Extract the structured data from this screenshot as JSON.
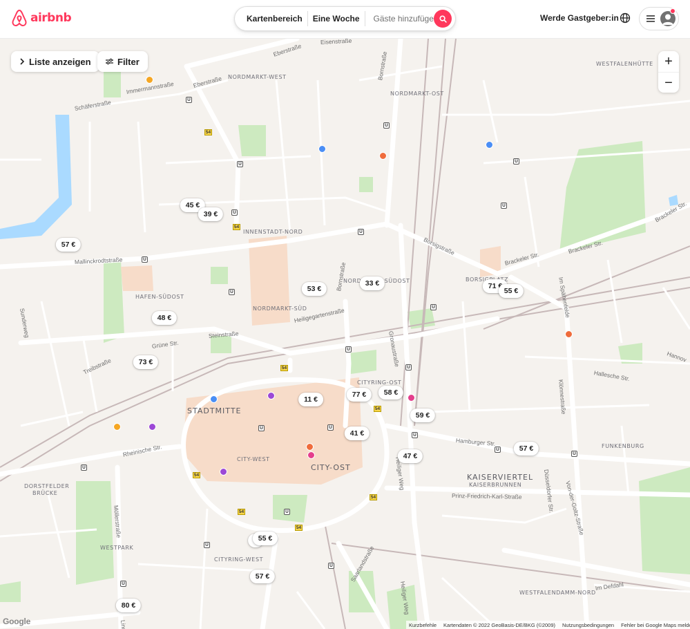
{
  "header": {
    "brand": "airbnb",
    "search": {
      "location": "Kartenbereich",
      "dates": "Eine Woche",
      "guests_placeholder": "Gäste hinzufügen"
    },
    "host_link": "Werde Gastgeber:in",
    "icons": [
      "airbnb-logo-icon",
      "search-icon",
      "globe-icon",
      "menu-icon",
      "avatar-icon"
    ],
    "accent_color": "#ff385c"
  },
  "map_controls": {
    "show_list": "Liste anzeigen",
    "filter": "Filter",
    "zoom_in": "+",
    "zoom_out": "−"
  },
  "price_pins": [
    {
      "label": "45 €"
    },
    {
      "label": "39 €"
    },
    {
      "label": "57 €"
    },
    {
      "label": "53 €"
    },
    {
      "label": "33 €"
    },
    {
      "label": "71 €"
    },
    {
      "label": "55 €"
    },
    {
      "label": "48 €"
    },
    {
      "label": "73 €"
    },
    {
      "label": "11 €"
    },
    {
      "label": "77 €"
    },
    {
      "label": "58 €"
    },
    {
      "label": "59 €"
    },
    {
      "label": "41 €"
    },
    {
      "label": "47 €"
    },
    {
      "label": "57 €"
    },
    {
      "label": "5"
    },
    {
      "label": "55 €"
    },
    {
      "label": "57 €"
    },
    {
      "label": "80 €"
    }
  ],
  "districts": {
    "nordmarkt_west": "NORDMARKT-WEST",
    "nordmarkt_ost": "NORDMARKT-OST",
    "westfalenhuette": "WESTFALENHÜTTE",
    "innenstadt_nord": "INNENSTADT-NORD",
    "hafen_suedost": "HAFEN-SÜDOST",
    "nordmarkt_sued": "NORDMARKT-SÜD",
    "nordmarkt_suedost": "NORDMARKT-SÜDOST",
    "borsigplatz": "BORSIGPLATZ",
    "cityring_ost": "CITYRING-OST",
    "stadtmitte": "STADTMITTE",
    "city_west": "CITY-WEST",
    "city_ost": "CITY-OST",
    "kaiserviertel": "KAISERVIERTEL",
    "kaiserbrunnen": "KAISERBRUNNEN",
    "funkenburg": "FUNKENBURG",
    "dorstfelder": "DORSTFELDER",
    "bruecke": "BRÜCKE",
    "westpark": "WESTPARK",
    "cityring_west": "CITYRING-WEST",
    "westfalendamm_nord": "WESTFALENDAMM-NORD"
  },
  "streets": {
    "eisenstrasse": "Eisenstraße",
    "eberstrasse1": "Eberstraße",
    "eberstrasse2": "Eberstraße",
    "immermannstrasse": "Immermannstraße",
    "schaeferstrasse": "Schäferstraße",
    "bornstrasse_n": "Bornstraße",
    "mallinckrodtstrasse": "Mallinckrodtstraße",
    "borsigstrasse": "Borsigstraße",
    "brackeler1": "Brackeler Str.",
    "brackeler2": "Brackeler Str.",
    "brackeler3": "Brackeler Str.",
    "sunderweg": "Sunderweg",
    "heiligegartenstrasse": "Heiligegartenstraße",
    "bornstrasse_s": "Bornstraße",
    "im_spaethenfelde": "Im Spähenfelde",
    "steinstrasse": "Steinstraße",
    "gruene_str": "Grüne Str.",
    "gronaustrasse": "Gronaustraße",
    "treibstrasse": "Treibstraße",
    "hallesche_str": "Hallesche Str.",
    "hannoversche": "Hannov",
    "kloenestrasse": "Klönnestraße",
    "rheinische_str": "Rheinische Str.",
    "hamburger_str": "Hamburger Str.",
    "heiliger_weg": "Heiliger Weg",
    "duesseldorfer_str": "Düsseldorfer Str.",
    "von_der_goltz": "Von-der-Goltz-Straße",
    "prinz_friedrich": "Prinz-Friedrich-Karl-Straße",
    "moellerstrasse": "Möllerstraße",
    "saarlandstrasse": "Saarlandstraße",
    "heiliger_weg2": "Heiliger Weg",
    "im_defdahl": "Im Defdahl",
    "linden": "Lind"
  },
  "route_number": "54",
  "ubahn_label": "U",
  "footer": {
    "google": "Google",
    "shortcuts": "Kurzbefehle",
    "mapdata": "Kartendaten © 2022 GeoBasis-DE/BKG (©2009)",
    "terms": "Nutzungsbedingungen",
    "report": "Fehler bei Google Maps melden"
  }
}
